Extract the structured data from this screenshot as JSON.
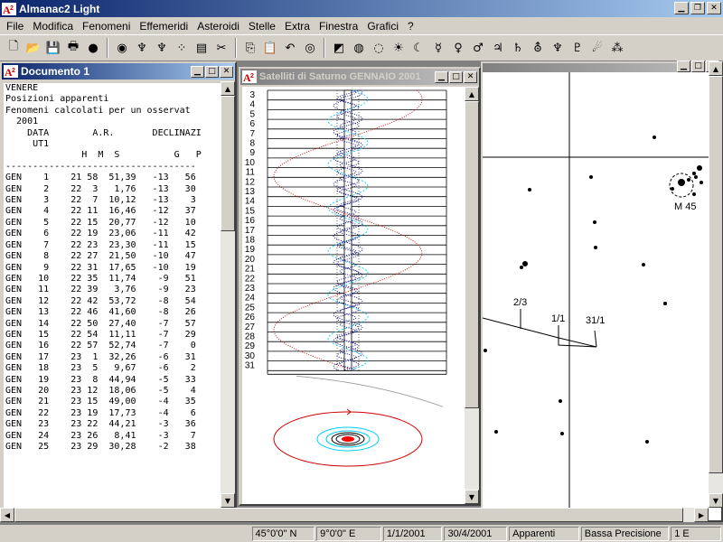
{
  "app": {
    "title": "Almanac2 Light",
    "icon": "almanac-a-icon"
  },
  "window_controls": [
    "minimize-icon",
    "restore-icon",
    "close-icon"
  ],
  "menubar": [
    "File",
    "Modifica",
    "Fenomeni",
    "Effemeridi",
    "Asteroidi",
    "Stelle",
    "Extra",
    "Finestra",
    "Grafici",
    "?"
  ],
  "toolbar_icons": [
    "new-icon",
    "open-icon",
    "save-icon",
    "print-icon",
    "mars-map-icon",
    "eye-icon",
    "figure-icon",
    "figure2-icon",
    "dots-icon",
    "book-icon",
    "cut-icon",
    "copy-icon",
    "paste-icon",
    "undo-icon",
    "planet-icon",
    "sunset-icon",
    "ring-icon",
    "orbit-icon",
    "sun-icon",
    "moon-icon",
    "mercury-icon",
    "venus-icon",
    "mars-icon",
    "jupiter-icon",
    "saturn-icon",
    "uranus-icon",
    "neptune-icon",
    "pluto-icon",
    "comet-icon",
    "stars-icon"
  ],
  "doc1": {
    "title": "Documento 1",
    "header_lines": [
      "VENERE",
      "Posizioni apparenti",
      "Fenomeni calcolati per un osservat",
      "  2001",
      "    DATA        A.R.       DECLINAZI",
      "     UT1",
      "              H  M  S          G   P",
      "-----------------------------------"
    ],
    "rows": [
      [
        "GEN",
        "1",
        "21",
        "58",
        "51,39",
        "-13",
        "56"
      ],
      [
        "GEN",
        "2",
        "22",
        "3",
        "1,76",
        "-13",
        "30"
      ],
      [
        "GEN",
        "3",
        "22",
        "7",
        "10,12",
        "-13",
        "3"
      ],
      [
        "GEN",
        "4",
        "22",
        "11",
        "16,46",
        "-12",
        "37"
      ],
      [
        "GEN",
        "5",
        "22",
        "15",
        "20,77",
        "-12",
        "10"
      ],
      [
        "GEN",
        "6",
        "22",
        "19",
        "23,06",
        "-11",
        "42"
      ],
      [
        "GEN",
        "7",
        "22",
        "23",
        "23,30",
        "-11",
        "15"
      ],
      [
        "GEN",
        "8",
        "22",
        "27",
        "21,50",
        "-10",
        "47"
      ],
      [
        "GEN",
        "9",
        "22",
        "31",
        "17,65",
        "-10",
        "19"
      ],
      [
        "GEN",
        "10",
        "22",
        "35",
        "11,74",
        "-9",
        "51"
      ],
      [
        "GEN",
        "11",
        "22",
        "39",
        "3,76",
        "-9",
        "23"
      ],
      [
        "GEN",
        "12",
        "22",
        "42",
        "53,72",
        "-8",
        "54"
      ],
      [
        "GEN",
        "13",
        "22",
        "46",
        "41,60",
        "-8",
        "26"
      ],
      [
        "GEN",
        "14",
        "22",
        "50",
        "27,40",
        "-7",
        "57"
      ],
      [
        "GEN",
        "15",
        "22",
        "54",
        "11,11",
        "-7",
        "29"
      ],
      [
        "GEN",
        "16",
        "22",
        "57",
        "52,74",
        "-7",
        "0"
      ],
      [
        "GEN",
        "17",
        "23",
        "1",
        "32,26",
        "-6",
        "31"
      ],
      [
        "GEN",
        "18",
        "23",
        "5",
        "9,67",
        "-6",
        "2"
      ],
      [
        "GEN",
        "19",
        "23",
        "8",
        "44,94",
        "-5",
        "33"
      ],
      [
        "GEN",
        "20",
        "23",
        "12",
        "18,06",
        "-5",
        "4"
      ],
      [
        "GEN",
        "21",
        "23",
        "15",
        "49,00",
        "-4",
        "35"
      ],
      [
        "GEN",
        "22",
        "23",
        "19",
        "17,73",
        "-4",
        "6"
      ],
      [
        "GEN",
        "23",
        "23",
        "22",
        "44,21",
        "-3",
        "36"
      ],
      [
        "GEN",
        "24",
        "23",
        "26",
        "8,41",
        "-3",
        "7"
      ],
      [
        "GEN",
        "25",
        "23",
        "29",
        "30,28",
        "-2",
        "38"
      ]
    ]
  },
  "saturn": {
    "title": "Satelliti di Saturno GENNAIO 2001",
    "days": [
      "3",
      "4",
      "5",
      "6",
      "7",
      "8",
      "9",
      "10",
      "11",
      "12",
      "13",
      "14",
      "15",
      "16",
      "17",
      "18",
      "19",
      "20",
      "21",
      "22",
      "23",
      "24",
      "25",
      "26",
      "27",
      "28",
      "29",
      "30",
      "31"
    ],
    "colors": {
      "titan": "#cc0000",
      "rhea": "#00ccff",
      "inner": "#000080",
      "planet": "#ff0000"
    }
  },
  "starmap": {
    "labels": [
      "M 45",
      "2/3",
      "1/1",
      "31/1"
    ]
  },
  "statusbar": [
    "45°0'0\" N",
    "9°0'0\" E",
    "1/1/2001",
    "30/4/2001",
    "Apparenti",
    "Bassa Precisione",
    "1 E"
  ]
}
